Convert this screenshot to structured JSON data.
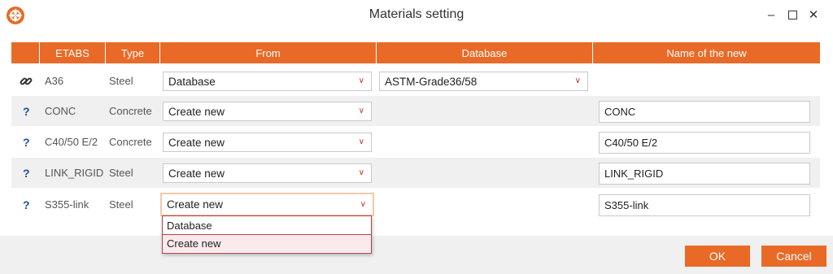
{
  "window": {
    "title": "Materials setting"
  },
  "columns": [
    "ETABS",
    "Type",
    "From",
    "Database",
    "Name of the new"
  ],
  "rows": [
    {
      "icon": "link-icon",
      "etabs": "A36",
      "type": "Steel",
      "from": "Database",
      "database": "ASTM-Grade36/58",
      "name": ""
    },
    {
      "icon": "question-icon",
      "icon_text": "?",
      "etabs": "CONC",
      "type": "Concrete",
      "from": "Create new",
      "database": "",
      "name": "CONC"
    },
    {
      "icon": "question-icon",
      "icon_text": "?",
      "etabs": "C40/50 E/2",
      "type": "Concrete",
      "from": "Create new",
      "database": "",
      "name": "C40/50 E/2"
    },
    {
      "icon": "question-icon",
      "icon_text": "?",
      "etabs": "LINK_RIGID",
      "type": "Steel",
      "from": "Create new",
      "database": "",
      "name": "LINK_RIGID"
    },
    {
      "icon": "question-icon",
      "icon_text": "?",
      "etabs": "S355-link",
      "type": "Steel",
      "from": "Create new",
      "database": "",
      "name": "S355-link"
    }
  ],
  "dropdown": {
    "options": [
      "Database",
      "Create new"
    ],
    "selected": "Create new"
  },
  "buttons": {
    "ok": "OK",
    "cancel": "Cancel"
  },
  "colors": {
    "accent": "#e96a27",
    "icon_blue": "#1d4f9a",
    "select_arrow": "#c0392b"
  }
}
